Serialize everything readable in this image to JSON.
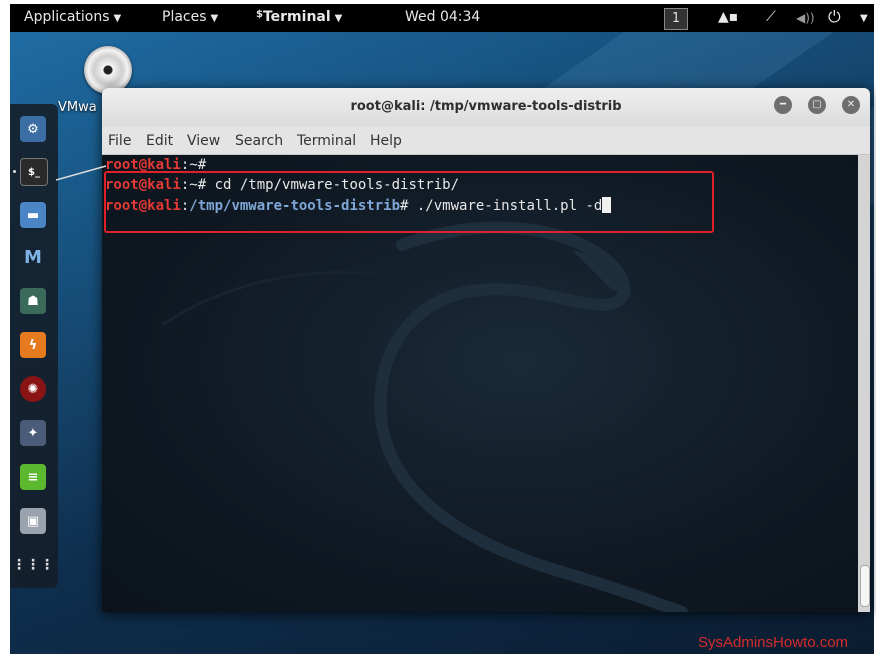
{
  "topbar": {
    "applications": "Applications",
    "places": "Places",
    "terminal_app": "Terminal",
    "clock": "Wed 04:34",
    "workspace": "1",
    "icons": [
      "camera-icon",
      "network-icon",
      "volume-icon",
      "power-icon"
    ]
  },
  "desktop": {
    "icon_label": "VMwa"
  },
  "dock": {
    "items": [
      "app-icon",
      "terminal-icon",
      "folder-icon",
      "metasploit-icon",
      "armitage-icon",
      "burpsuite-icon",
      "maltego-icon",
      "beef-icon",
      "notes-icon",
      "settings-icon",
      "apps-grid-icon"
    ]
  },
  "window": {
    "title": "root@kali: /tmp/vmware-tools-distrib",
    "menu": [
      "File",
      "Edit",
      "View",
      "Search",
      "Terminal",
      "Help"
    ]
  },
  "terminal": {
    "line1": {
      "user": "root@kali",
      "sep": ":~#",
      "cmd": ""
    },
    "line2": {
      "user": "root@kali",
      "sep": ":~#",
      "cmd": " cd /tmp/vmware-tools-distrib/"
    },
    "line3": {
      "user": "root@kali",
      "sep": ":",
      "path": "/tmp/vmware-tools-distrib",
      "prompt": "#",
      "cmd": " ./vmware-install.pl -d"
    }
  },
  "watermark": "SysAdminsHowto.com",
  "colors": {
    "highlight_box": "#e0202a",
    "user": "#e53935",
    "path": "#7fa7d8"
  }
}
